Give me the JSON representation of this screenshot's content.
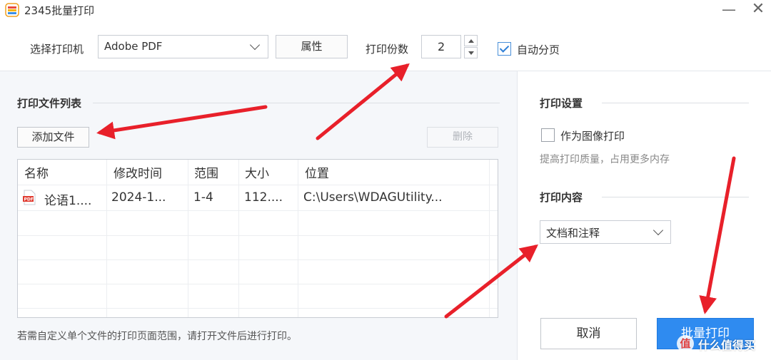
{
  "window": {
    "title": "2345批量打印",
    "minimize_glyph": "—",
    "close_glyph": "✕"
  },
  "toolbar": {
    "printer_label": "选择打印机",
    "printer_value": "Adobe PDF",
    "properties_label": "属性",
    "copies_label": "打印份数",
    "copies_value": "2",
    "auto_paging_label": "自动分页",
    "auto_paging_checked": true
  },
  "file_list": {
    "title": "打印文件列表",
    "add_label": "添加文件",
    "delete_label": "删除",
    "columns": [
      "名称",
      "修改时间",
      "范围",
      "大小",
      "位置"
    ],
    "rows": [
      {
        "name": "论语1....",
        "modified": "2024-1...",
        "range": "1-4",
        "size": "112....",
        "location": "C:\\Users\\WDAGUtility..."
      }
    ],
    "hint": "若需自定义单个文件的打印页面范围，请打开文件后进行打印。"
  },
  "print_settings": {
    "title": "打印设置",
    "image_print_label": "作为图像打印",
    "image_print_checked": false,
    "image_print_desc": "提高打印质量，占用更多内存"
  },
  "print_content": {
    "title": "打印内容",
    "value": "文档和注释"
  },
  "actions": {
    "cancel_label": "取消",
    "batch_print_label": "批量打印"
  },
  "watermark": {
    "badge": "值",
    "text": "什么值得买"
  },
  "colors": {
    "accent": "#2f8bf0",
    "annotation_arrow": "#e8202a"
  },
  "icons": {
    "app": "app-logo-icon",
    "file_type": "pdf-file-icon",
    "dropdown": "chevron-down-icon"
  }
}
